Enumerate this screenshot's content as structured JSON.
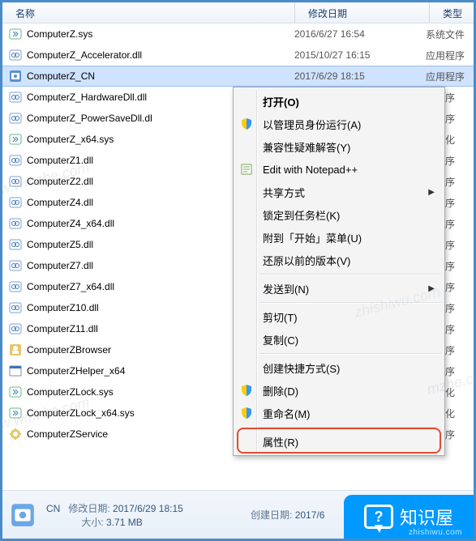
{
  "columns": {
    "name": "名称",
    "date": "修改日期",
    "type": "类型"
  },
  "files": [
    {
      "name": "ComputerZ.sys",
      "date": "2016/6/27 16:54",
      "type": "系统文件",
      "icon": "sys"
    },
    {
      "name": "ComputerZ_Accelerator.dll",
      "date": "2015/10/27 16:15",
      "type": "应用程序",
      "icon": "dll"
    },
    {
      "name": "ComputerZ_CN",
      "date": "2017/6/29 18:15",
      "type": "应用程序",
      "icon": "app",
      "selected": true
    },
    {
      "name": "ComputerZ_HardwareDll.dll",
      "date": "",
      "type": "用程序",
      "icon": "dll"
    },
    {
      "name": "ComputerZ_PowerSaveDll.dl",
      "date": "",
      "type": "用程序",
      "icon": "dll"
    },
    {
      "name": "ComputerZ_x64.sys",
      "date": "",
      "type": "充文化",
      "icon": "sys"
    },
    {
      "name": "ComputerZ1.dll",
      "date": "",
      "type": "用程序",
      "icon": "dll"
    },
    {
      "name": "ComputerZ2.dll",
      "date": "",
      "type": "用程序",
      "icon": "dll"
    },
    {
      "name": "ComputerZ4.dll",
      "date": "",
      "type": "用程序",
      "icon": "dll"
    },
    {
      "name": "ComputerZ4_x64.dll",
      "date": "",
      "type": "用程序",
      "icon": "dll"
    },
    {
      "name": "ComputerZ5.dll",
      "date": "",
      "type": "用程序",
      "icon": "dll"
    },
    {
      "name": "ComputerZ7.dll",
      "date": "",
      "type": "用程序",
      "icon": "dll"
    },
    {
      "name": "ComputerZ7_x64.dll",
      "date": "",
      "type": "用程序",
      "icon": "dll"
    },
    {
      "name": "ComputerZ10.dll",
      "date": "",
      "type": "用程序",
      "icon": "dll"
    },
    {
      "name": "ComputerZ11.dll",
      "date": "",
      "type": "用程序",
      "icon": "dll"
    },
    {
      "name": "ComputerZBrowser",
      "date": "",
      "type": "用程序",
      "icon": "app2"
    },
    {
      "name": "ComputerZHelper_x64",
      "date": "",
      "type": "用程序",
      "icon": "exe"
    },
    {
      "name": "ComputerZLock.sys",
      "date": "",
      "type": "充文化",
      "icon": "sys"
    },
    {
      "name": "ComputerZLock_x64.sys",
      "date": "",
      "type": "充文化",
      "icon": "sys"
    },
    {
      "name": "ComputerZService",
      "date": "",
      "type": "用程序",
      "icon": "svc"
    }
  ],
  "context_menu": [
    {
      "label": "打开(O)",
      "bold": true
    },
    {
      "label": "以管理员身份运行(A)",
      "icon": "shield"
    },
    {
      "label": "兼容性疑难解答(Y)"
    },
    {
      "label": "Edit with Notepad++",
      "icon": "npp"
    },
    {
      "label": "共享方式",
      "arrow": true
    },
    {
      "label": "锁定到任务栏(K)"
    },
    {
      "label": "附到「开始」菜单(U)"
    },
    {
      "label": "还原以前的版本(V)"
    },
    {
      "divider": true
    },
    {
      "label": "发送到(N)",
      "arrow": true
    },
    {
      "divider": true
    },
    {
      "label": "剪切(T)"
    },
    {
      "label": "复制(C)"
    },
    {
      "divider": true
    },
    {
      "label": "创建快捷方式(S)"
    },
    {
      "label": "删除(D)",
      "icon": "shield"
    },
    {
      "label": "重命名(M)",
      "icon": "shield"
    },
    {
      "divider": true
    },
    {
      "label": "属性(R)",
      "highlight": true
    }
  ],
  "footer": {
    "left_suffix": "CN",
    "mod_label": "修改日期:",
    "mod_value": "2017/6/29 18:15",
    "size_label": "大小:",
    "size_value": "3.71 MB",
    "created_label": "创建日期:",
    "created_value": "2017/6"
  },
  "brand": {
    "text": "知识屋",
    "bubble": "?",
    "sub": "zhishiwu.com"
  },
  "watermarks": [
    "www.wmzhe.com",
    "www.wmzhe.com",
    "mzhe.co",
    "zhishiwu.com"
  ]
}
